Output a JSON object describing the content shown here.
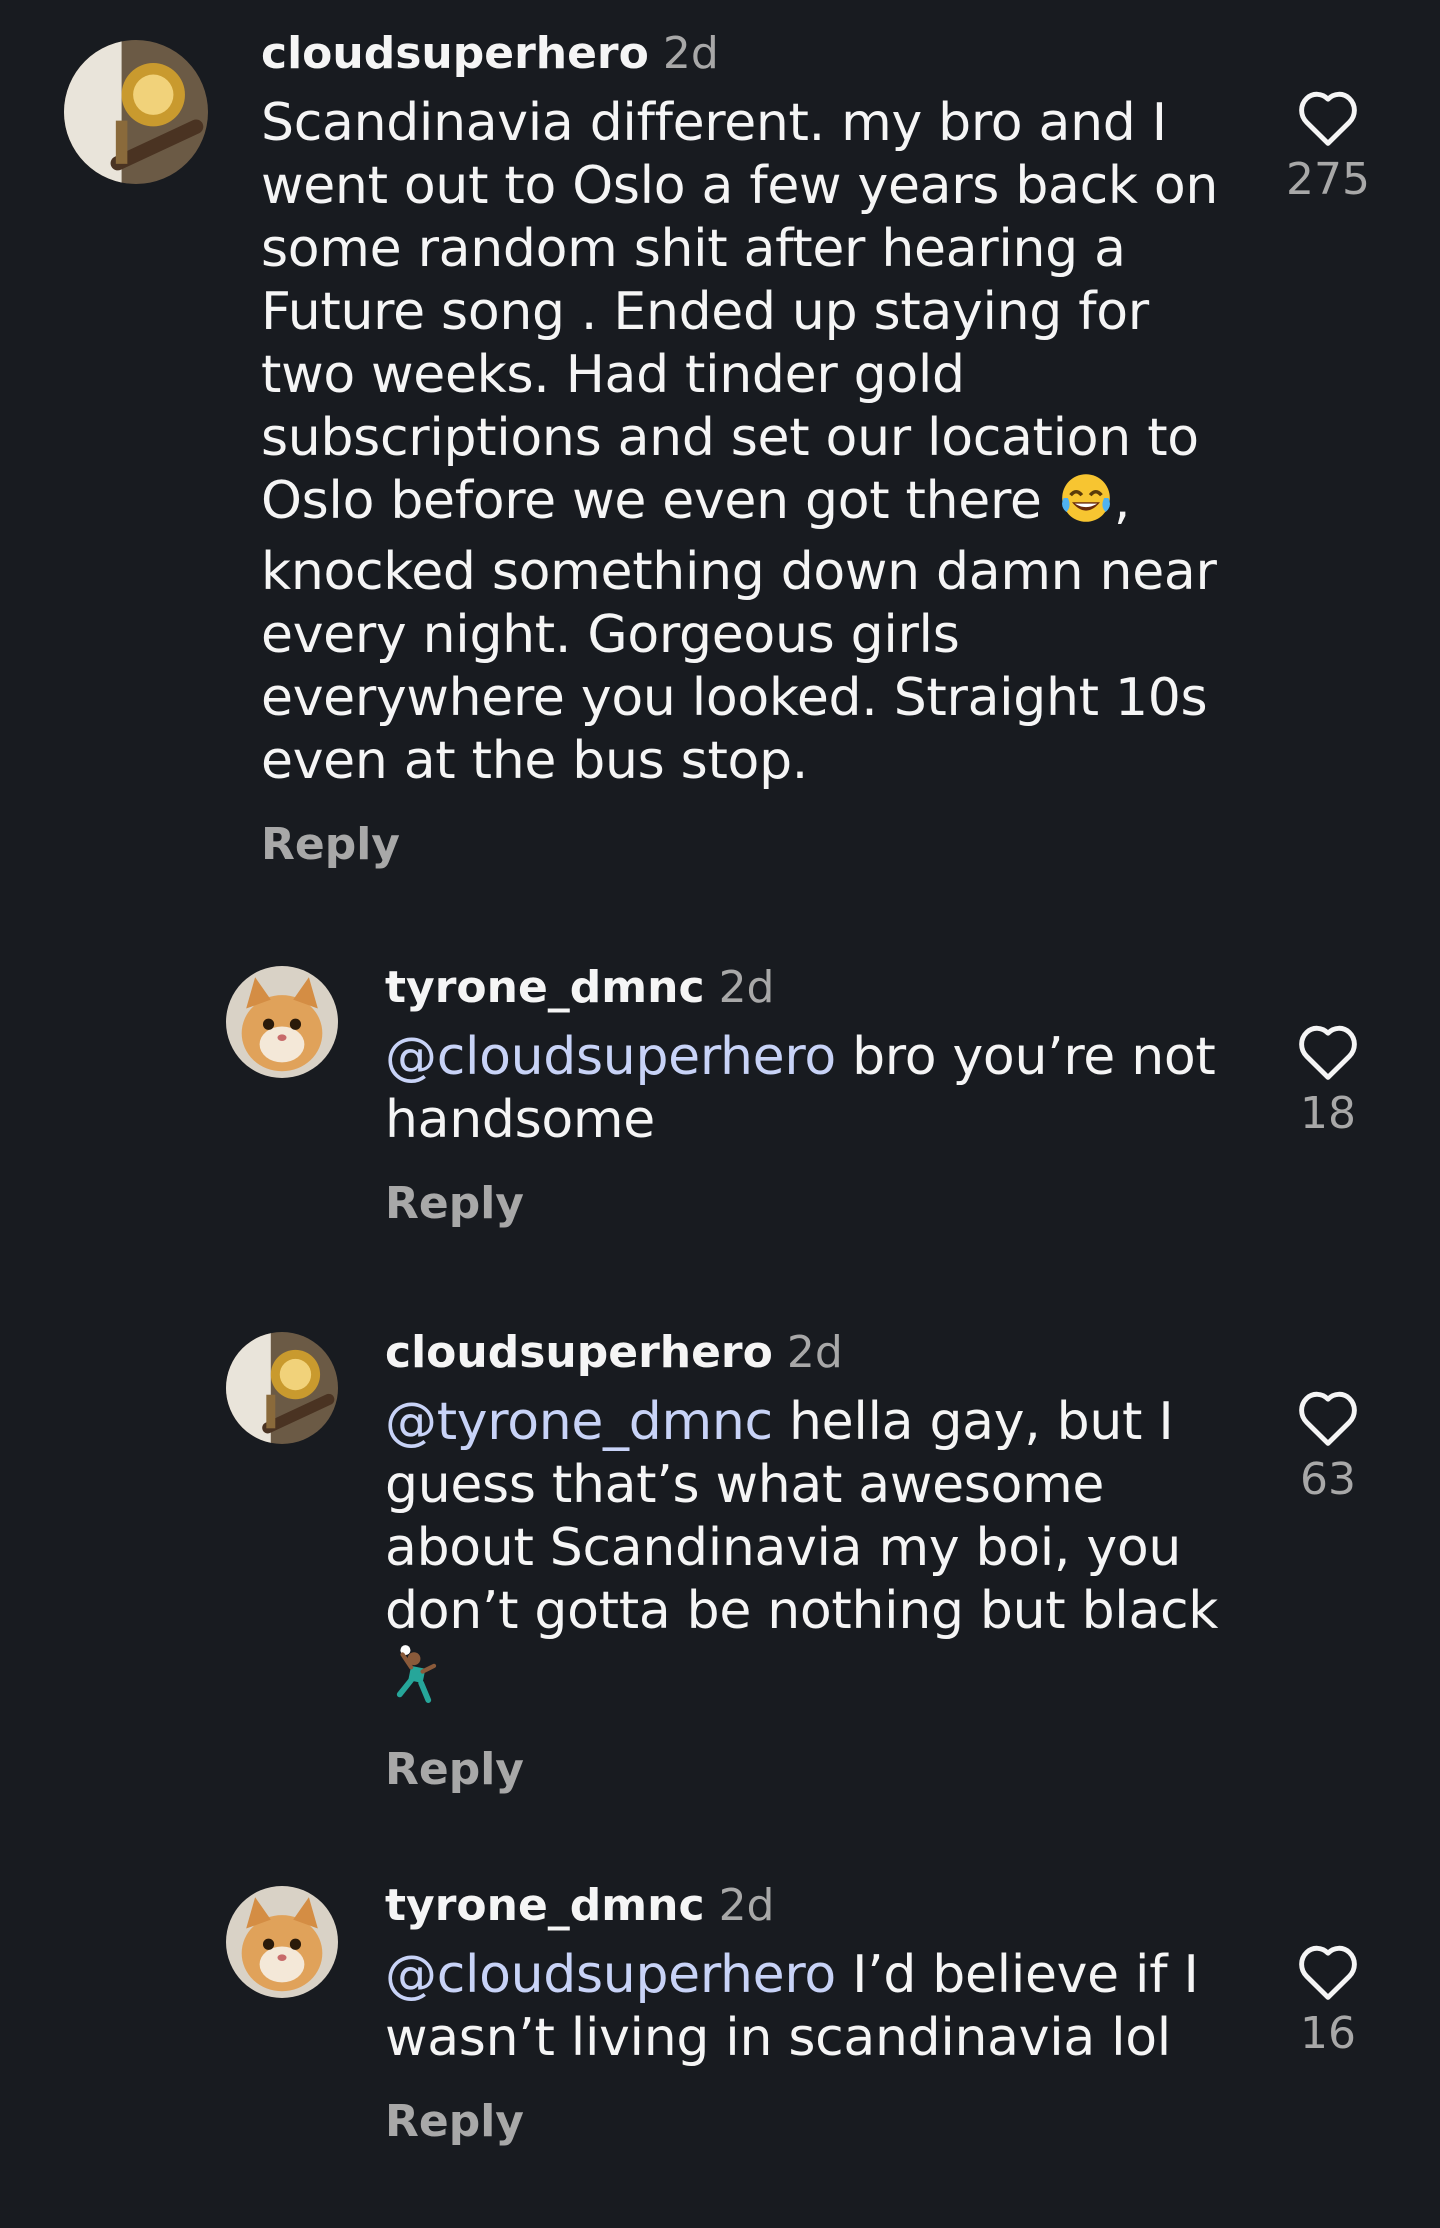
{
  "colors": {
    "background": "#181b20",
    "text": "#f5f5f5",
    "muted": "#a8a8a8",
    "mention": "#c8d3f7"
  },
  "comments": [
    {
      "username": "cloudsuperhero",
      "time": "2d",
      "text_before": "Scandinavia different. my bro and I went out to Oslo a few years back on some random shit after hearing a Future song . Ended up staying for two weeks. Had tinder gold subscriptions and set our location to Oslo before we even got there",
      "emoji": "😂",
      "text_after": ", knocked something down damn near every night. Gorgeous girls everywhere you looked. Straight 10s even at the bus stop.",
      "reply_label": "Reply",
      "likes": "275",
      "avatar_icon": "whiskey-cigar-avatar"
    },
    {
      "username": "tyrone_dmnc",
      "time": "2d",
      "mention": "@cloudsuperhero",
      "text": " bro you’re not handsome",
      "reply_label": "Reply",
      "likes": "18",
      "avatar_icon": "cat-avatar"
    },
    {
      "username": "cloudsuperhero",
      "time": "2d",
      "mention": "@tyrone_dmnc",
      "text": " hella gay, but I guess that’s what awesome about Scandinavia my boi, you don’t gotta be nothing but black ",
      "emoji": "🤾🏽‍♂️",
      "reply_label": "Reply",
      "likes": "63",
      "avatar_icon": "whiskey-cigar-avatar"
    },
    {
      "username": "tyrone_dmnc",
      "time": "2d",
      "mention": "@cloudsuperhero",
      "text": " I’d believe if I wasn’t living in scandinavia lol",
      "reply_label": "Reply",
      "likes": "16",
      "avatar_icon": "cat-avatar"
    }
  ]
}
